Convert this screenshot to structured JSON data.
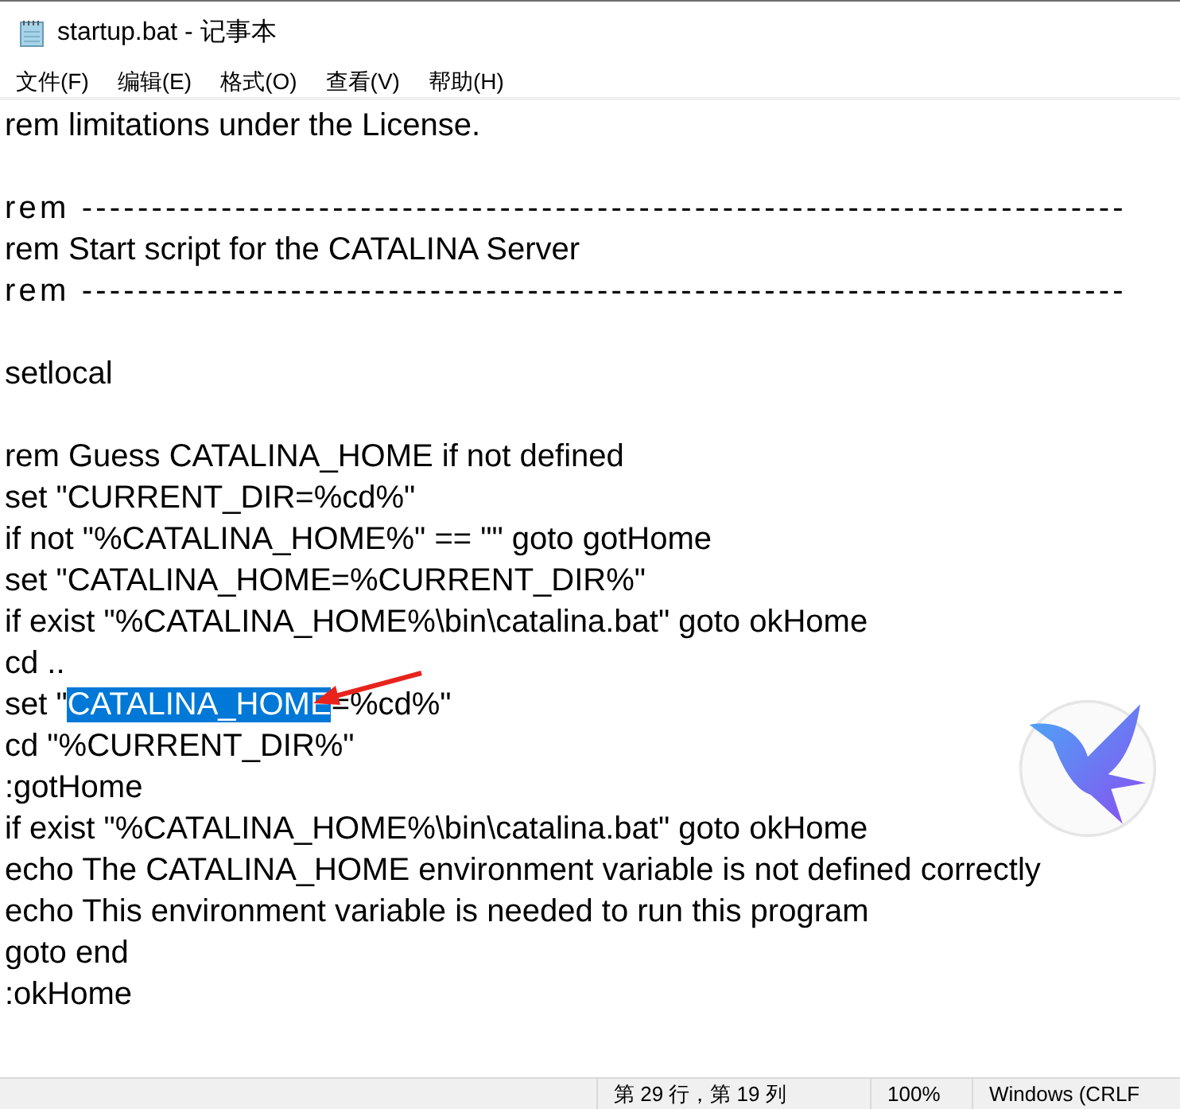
{
  "window": {
    "title": "startup.bat - 记事本"
  },
  "menu": [
    "文件(F)",
    "编辑(E)",
    "格式(O)",
    "查看(V)",
    "帮助(H)"
  ],
  "editor": {
    "lines": [
      {
        "kind": "code",
        "text": "rem limitations under the License."
      },
      {
        "kind": "blank"
      },
      {
        "kind": "rule",
        "text": "rem ---------------------------------------------------------------------------"
      },
      {
        "kind": "code",
        "text": "rem Start script for the CATALINA Server"
      },
      {
        "kind": "rule",
        "text": "rem ---------------------------------------------------------------------------"
      },
      {
        "kind": "blank"
      },
      {
        "kind": "code",
        "text": "setlocal"
      },
      {
        "kind": "blank"
      },
      {
        "kind": "code",
        "text": "rem Guess CATALINA_HOME if not defined"
      },
      {
        "kind": "code",
        "text": "set \"CURRENT_DIR=%cd%\""
      },
      {
        "kind": "code",
        "text": "if not \"%CATALINA_HOME%\" == \"\" goto gotHome"
      },
      {
        "kind": "code",
        "text": "set \"CATALINA_HOME=%CURRENT_DIR%\""
      },
      {
        "kind": "code",
        "text": "if exist \"%CATALINA_HOME%\\bin\\catalina.bat\" goto okHome"
      },
      {
        "kind": "code",
        "text": "cd .."
      },
      {
        "kind": "parts",
        "parts": [
          {
            "text": "set \"",
            "selected": false
          },
          {
            "text": "CATALINA_HOME",
            "selected": true
          },
          {
            "text": "=%cd%\"",
            "selected": false
          }
        ]
      },
      {
        "kind": "code",
        "text": "cd \"%CURRENT_DIR%\""
      },
      {
        "kind": "code",
        "text": ":gotHome"
      },
      {
        "kind": "code",
        "text": "if exist \"%CATALINA_HOME%\\bin\\catalina.bat\" goto okHome"
      },
      {
        "kind": "code",
        "text": "echo The CATALINA_HOME environment variable is not defined correctly"
      },
      {
        "kind": "code",
        "text": "echo This environment variable is needed to run this program"
      },
      {
        "kind": "code",
        "text": "goto end"
      },
      {
        "kind": "code",
        "text": ":okHome"
      }
    ]
  },
  "status_bar": {
    "position": "第 29 行，第 19 列",
    "zoom": "100%",
    "line_ending": "Windows (CRLF"
  }
}
